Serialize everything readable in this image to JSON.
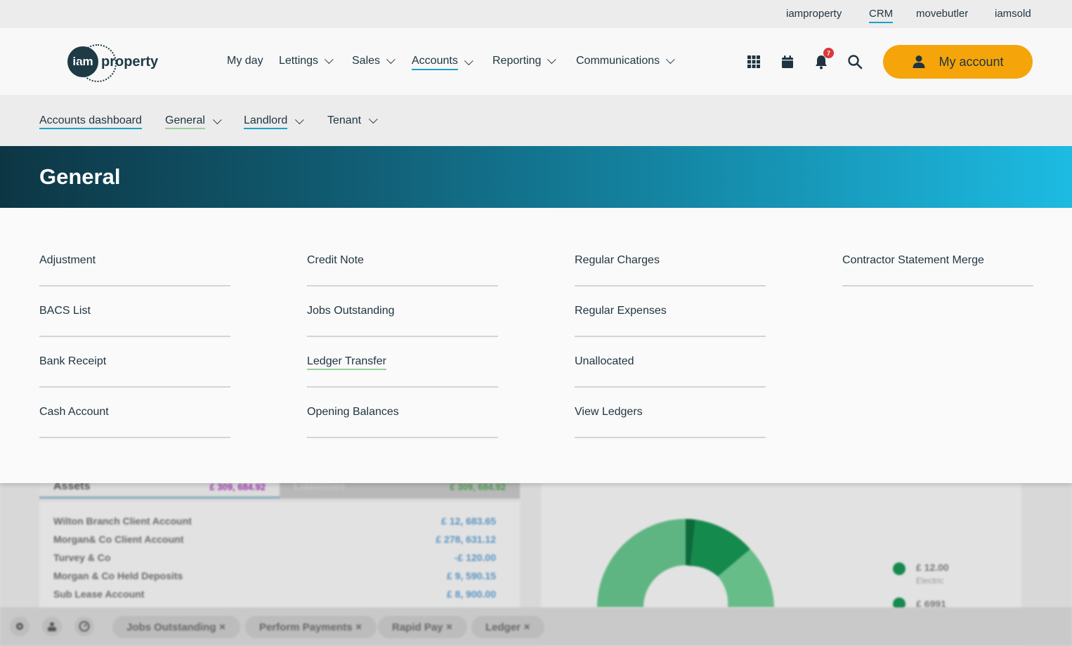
{
  "topbar": {
    "links": [
      {
        "label": "iamproperty",
        "active": false
      },
      {
        "label": "CRM",
        "active": true
      },
      {
        "label": "movebutler",
        "active": false
      },
      {
        "label": "iamsold",
        "active": false
      }
    ]
  },
  "header": {
    "logo": {
      "mark": "iam",
      "word": "property"
    },
    "nav": [
      {
        "label": "My day",
        "dropdown": false,
        "active": false
      },
      {
        "label": "Lettings",
        "dropdown": true,
        "active": false
      },
      {
        "label": "Sales",
        "dropdown": true,
        "active": false
      },
      {
        "label": "Accounts",
        "dropdown": true,
        "active": true
      },
      {
        "label": "Reporting",
        "dropdown": true,
        "active": false
      },
      {
        "label": "Communications",
        "dropdown": true,
        "active": false
      }
    ],
    "icons": [
      "apps-grid-icon",
      "calendar-icon",
      "bell-icon",
      "search-icon"
    ],
    "notification_count": "7",
    "account_button": "My account",
    "account_color": "#f5a50a"
  },
  "subnav": {
    "items": [
      {
        "label": "Accounts dashboard",
        "dropdown": false,
        "underline": "blue"
      },
      {
        "label": "General",
        "dropdown": true,
        "underline": "green"
      },
      {
        "label": "Landlord",
        "dropdown": true,
        "underline": "blue"
      },
      {
        "label": "Tenant",
        "dropdown": true,
        "underline": "none"
      }
    ]
  },
  "banner": {
    "title": "General"
  },
  "menu": {
    "columns": [
      [
        "Adjustment",
        "BACS List",
        "Bank Receipt",
        "Cash Account"
      ],
      [
        "Credit Note",
        "Jobs Outstanding",
        "Ledger Transfer",
        "Opening Balances"
      ],
      [
        "Regular Charges",
        "Regular Expenses",
        "Unallocated",
        "View Ledgers"
      ],
      [
        "Contractor Statement Merge"
      ]
    ],
    "highlighted": "Ledger Transfer"
  },
  "background": {
    "tabs": [
      {
        "label": "Assets",
        "value": "£ 309, 684.92"
      },
      {
        "label": "Liabilities",
        "value": "£ 309, 684.92"
      }
    ],
    "accounts": [
      {
        "name": "Wilton Branch Client Account",
        "amount": "£ 12, 683.65"
      },
      {
        "name": "Morgan& Co Client Account",
        "amount": "£ 278, 631.12"
      },
      {
        "name": "Turvey & Co",
        "amount": "-£ 120.00"
      },
      {
        "name": "Morgan & Co Held Deposits",
        "amount": "£ 9, 590.15"
      },
      {
        "name": "Sub Lease Account",
        "amount": "£ 8, 900.00"
      }
    ],
    "chart_legend": [
      {
        "amount": "£ 12.00",
        "label": "Electric"
      },
      {
        "amount": "£ 6991",
        "label": ""
      }
    ]
  },
  "bottombar": {
    "icons": [
      "settings-icon",
      "people-icon",
      "dashboard-icon"
    ],
    "chips": [
      "Jobs Outstanding",
      "Perform Payments",
      "Rapid Pay",
      "Ledger"
    ]
  }
}
